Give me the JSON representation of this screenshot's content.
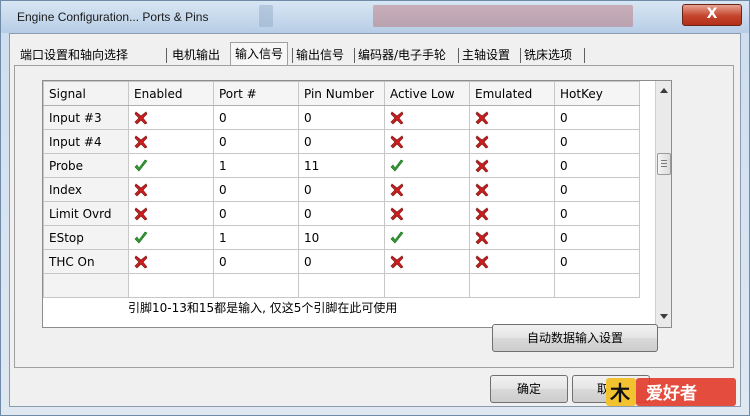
{
  "window": {
    "title": "Engine Configuration... Ports & Pins",
    "close_label": "X"
  },
  "tabs": [
    {
      "label": "端口设置和轴向选择",
      "active": false
    },
    {
      "label": "电机输出",
      "active": false
    },
    {
      "label": "输入信号",
      "active": true
    },
    {
      "label": "输出信号",
      "active": false
    },
    {
      "label": "编码器/电子手轮",
      "active": false
    },
    {
      "label": "主轴设置",
      "active": false
    },
    {
      "label": "铣床选项",
      "active": false
    }
  ],
  "grid": {
    "columns": [
      "Signal",
      "Enabled",
      "Port #",
      "Pin Number",
      "Active Low",
      "Emulated",
      "HotKey"
    ],
    "rows": [
      {
        "signal": "Input #3",
        "enabled": false,
        "port": "0",
        "pin": "0",
        "active_low": false,
        "emulated": false,
        "hotkey": "0"
      },
      {
        "signal": "Input #4",
        "enabled": false,
        "port": "0",
        "pin": "0",
        "active_low": false,
        "emulated": false,
        "hotkey": "0"
      },
      {
        "signal": "Probe",
        "enabled": true,
        "port": "1",
        "pin": "11",
        "active_low": true,
        "emulated": false,
        "hotkey": "0"
      },
      {
        "signal": "Index",
        "enabled": false,
        "port": "0",
        "pin": "0",
        "active_low": false,
        "emulated": false,
        "hotkey": "0"
      },
      {
        "signal": "Limit Ovrd",
        "enabled": false,
        "port": "0",
        "pin": "0",
        "active_low": false,
        "emulated": false,
        "hotkey": "0"
      },
      {
        "signal": "EStop",
        "enabled": true,
        "port": "1",
        "pin": "10",
        "active_low": true,
        "emulated": false,
        "hotkey": "0"
      },
      {
        "signal": "THC On",
        "enabled": false,
        "port": "0",
        "pin": "0",
        "active_low": false,
        "emulated": false,
        "hotkey": "0"
      }
    ]
  },
  "note": "引脚10-13和15都是输入, 仅这5个引脚在此可使用",
  "buttons": {
    "auto_input": "自动数据输入设置",
    "ok": "确定",
    "cancel": "取"
  },
  "colors": {
    "check": "#2e9a2e",
    "cross": "#c81e1e"
  },
  "icons": {
    "enabled_true": "check-icon",
    "enabled_false": "cross-icon"
  },
  "watermark_text": "爱好者"
}
